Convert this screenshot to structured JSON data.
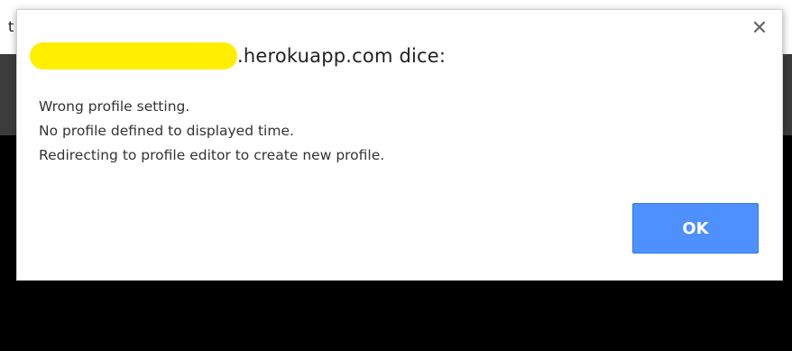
{
  "background": {
    "edge_text": "t"
  },
  "dialog": {
    "title_suffix": ".herokuapp.com dice:",
    "message_lines": [
      "Wrong profile setting.",
      "No profile defined to displayed time.",
      "Redirecting to profile editor to create new profile."
    ],
    "ok_label": "OK",
    "close_glyph": "✕"
  },
  "colors": {
    "redaction": "#ffee00",
    "ok_button": "#4d90fe"
  }
}
